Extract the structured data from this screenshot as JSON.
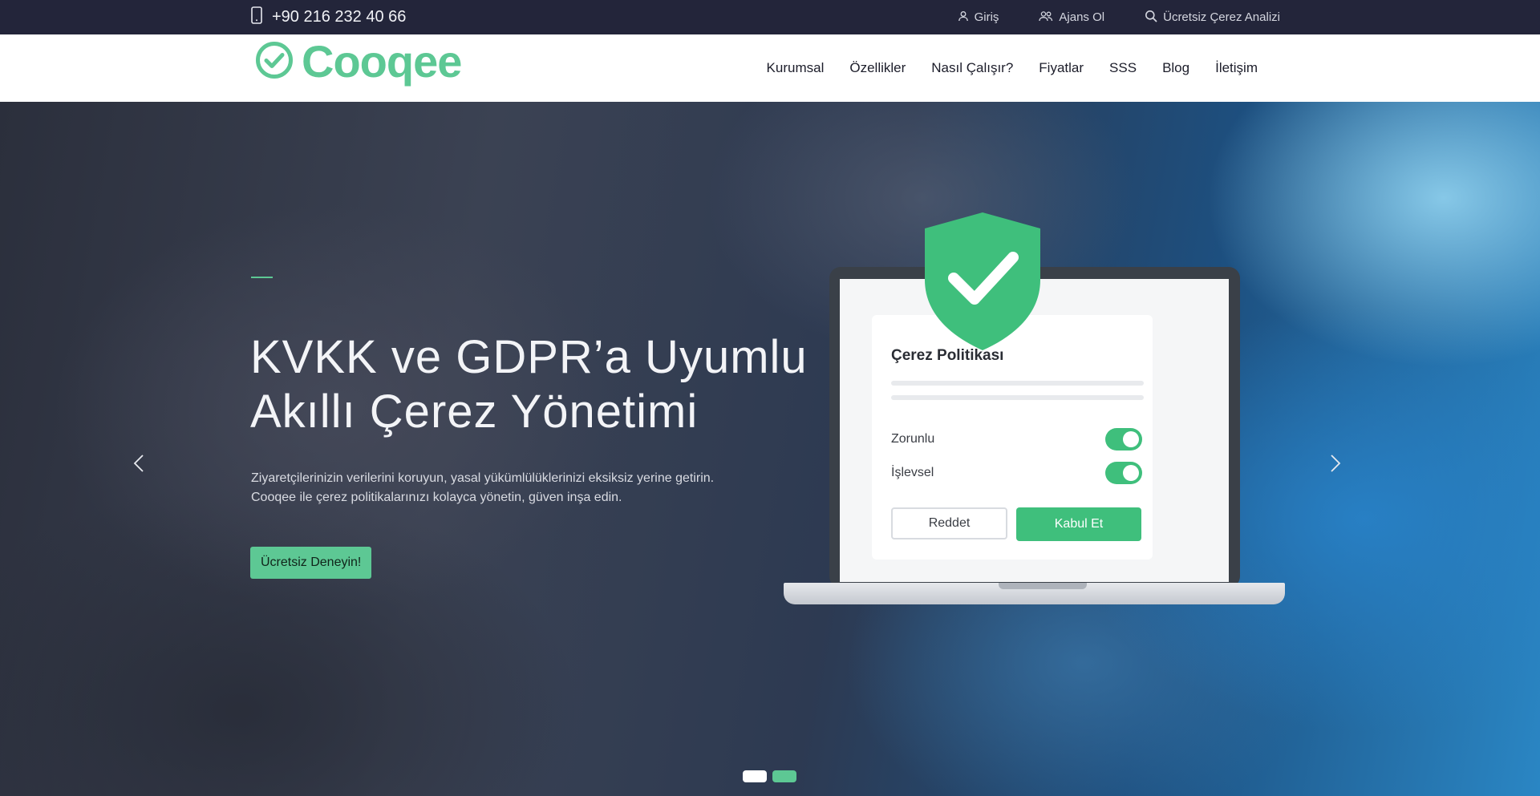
{
  "topbar": {
    "phone": "+90 216 232 40 66",
    "links": [
      {
        "label": "Giriş",
        "icon": "user-icon"
      },
      {
        "label": "Ajans Ol",
        "icon": "users-icon"
      },
      {
        "label": "Ücretsiz Çerez Analizi",
        "icon": "search-icon"
      }
    ]
  },
  "header": {
    "logo_text": "Cooqee",
    "nav": [
      "Kurumsal",
      "Özellikler",
      "Nasıl Çalışır?",
      "Fiyatlar",
      "SSS",
      "Blog",
      "İletişim"
    ]
  },
  "hero": {
    "title_line1": "KVKK ve GDPR’a Uyumlu",
    "title_line2": "Akıllı Çerez Yönetimi",
    "subtitle_line1": "Ziyaretçilerinizin verilerini koruyun, yasal yükümlülüklerinizi eksiksiz yerine getirin.",
    "subtitle_line2": "Cooqee ile çerez politikalarınızı kolayca yönetin, güven inşa edin.",
    "cta": "Ücretsiz Deneyin!",
    "slides_total": 2,
    "active_slide": 1
  },
  "illustration": {
    "card_title": "Çerez Politikası",
    "options": [
      {
        "label": "Zorunlu",
        "enabled": true
      },
      {
        "label": "İşlevsel",
        "enabled": true
      }
    ],
    "reject_label": "Reddet",
    "accept_label": "Kabul Et"
  },
  "colors": {
    "brand_green": "#5dc894",
    "toggle_green": "#3fbf7c",
    "topbar_bg": "#23253a"
  }
}
